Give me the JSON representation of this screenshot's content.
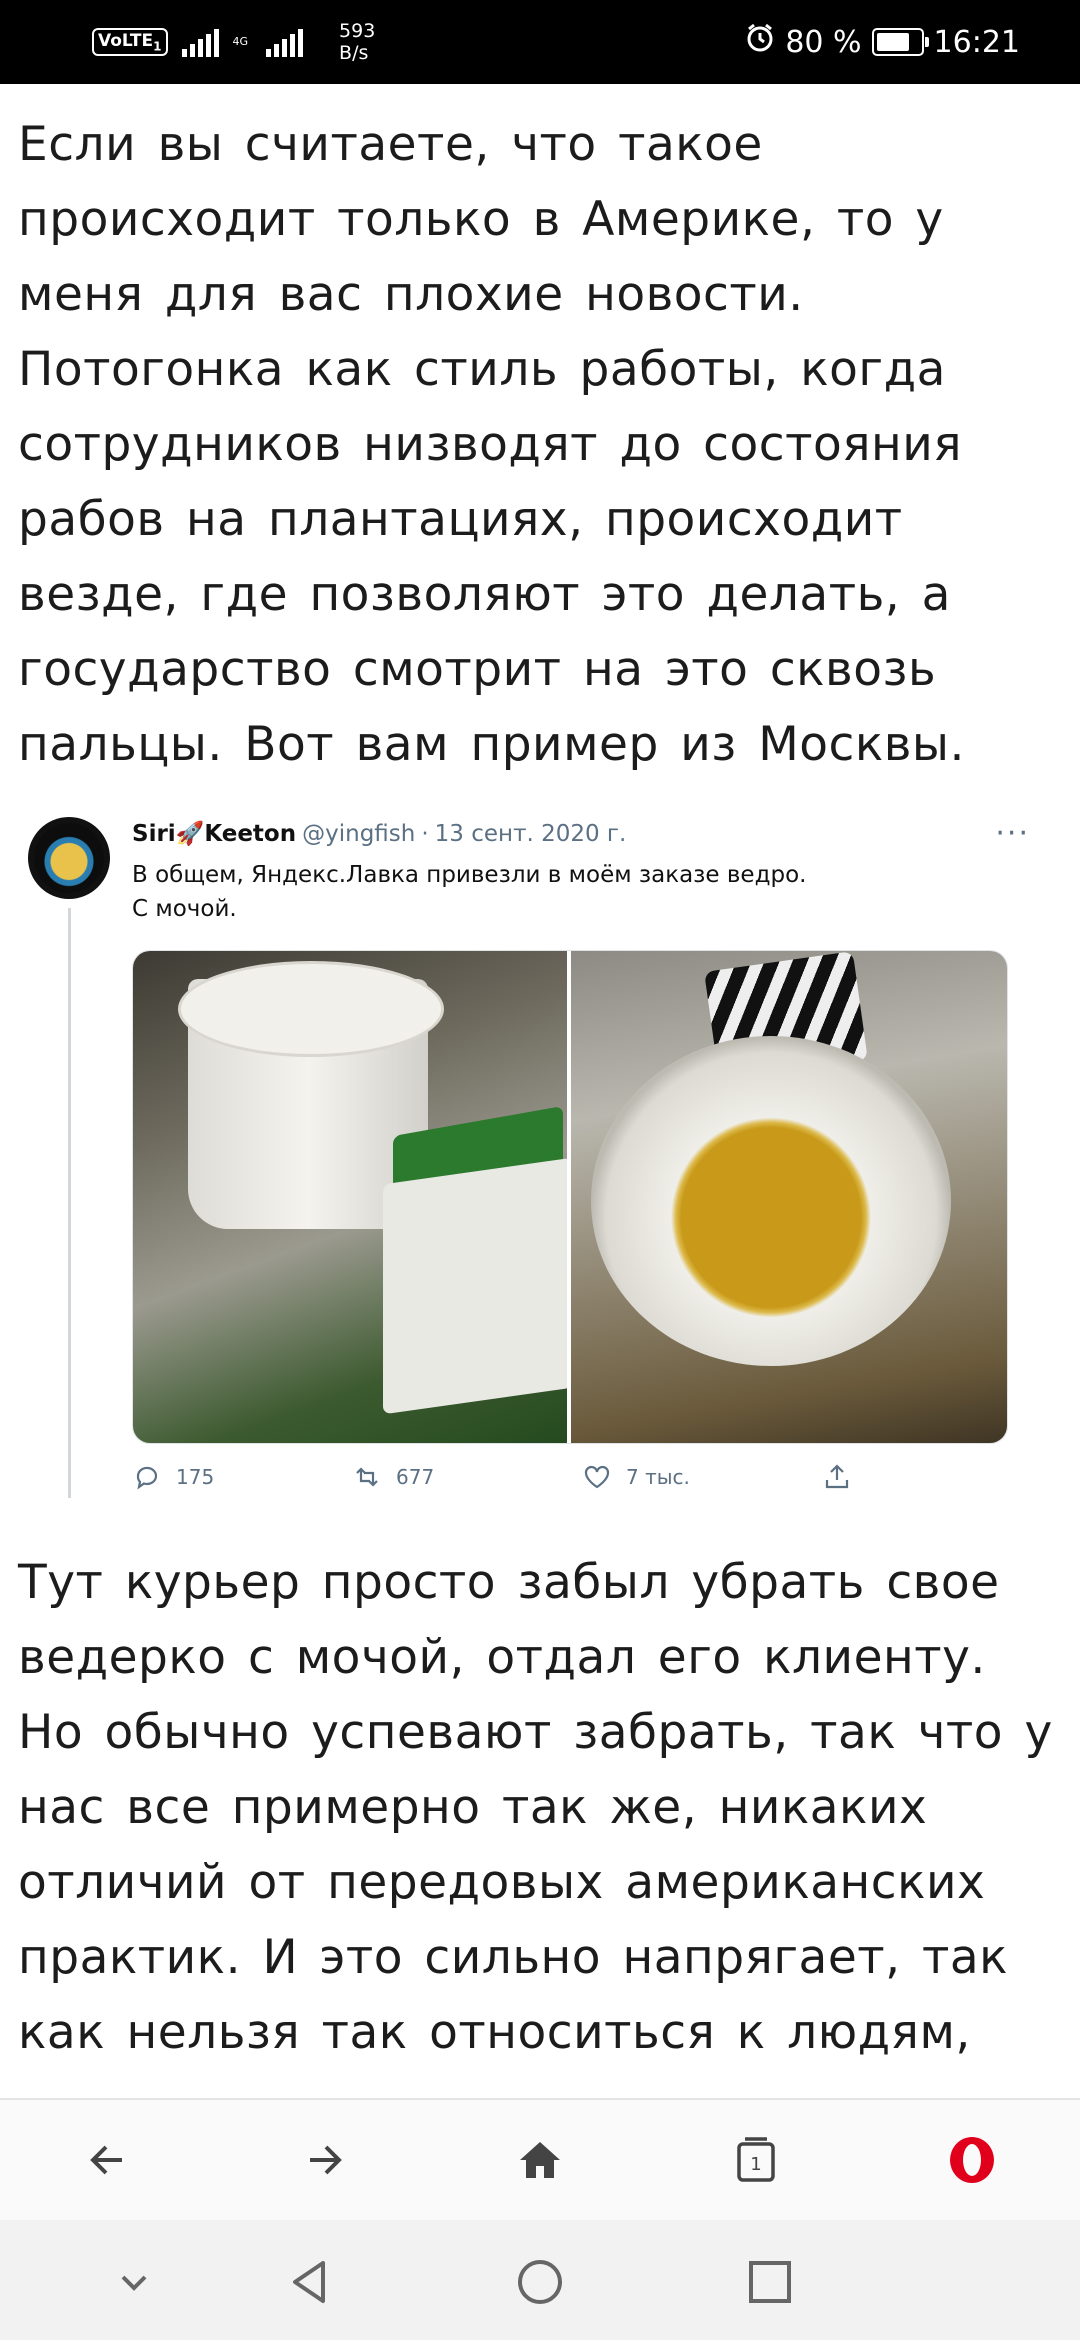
{
  "status_bar": {
    "volte": "VoLTE",
    "volte_sim": "1",
    "network": "4G",
    "speed_value": "593",
    "speed_unit": "B/s",
    "battery": "80 %",
    "battery_level": 0.8,
    "time": "16:21"
  },
  "article": {
    "paragraph_1_lines": [
      "Если вы считаете, что такое",
      "происходит только в Америке, то у",
      "меня для вас плохие новости.",
      "Потогонка как стиль работы, когда",
      "сотрудников низводят до состояния",
      "рабов на плантациях, происходит",
      "везде, где позволяют это делать, а",
      "государство смотрит на это сквозь",
      "пальцы. Вот вам пример из Москвы."
    ],
    "paragraph_2_lines": [
      "Тут курьер просто забыл убрать свое",
      "ведерко с мочой, отдал его клиенту.",
      "Но обычно успевают забрать, так что у",
      "нас все примерно так же, никаких",
      "отличий от передовых американских",
      "практик. И это сильно напрягает, так",
      "как нельзя так относиться к людям,"
    ]
  },
  "tweet": {
    "name": "Siri🚀Keeton",
    "handle": "@yingfish",
    "separator": "·",
    "date": "13 сент. 2020 г.",
    "more": "···",
    "text": "В общем, Яндекс.Лавка привезли в моём заказе ведро.\nС мочой.",
    "replies": "175",
    "retweets": "677",
    "likes": "7 тыс.",
    "icons": [
      "reply-icon",
      "retweet-icon",
      "heart-icon",
      "share-icon"
    ]
  },
  "browser_bar": {
    "tab_count": "1",
    "buttons": [
      "back-icon",
      "forward-icon",
      "home-icon",
      "tabs-icon",
      "opera-icon"
    ],
    "accent": "#e0001b"
  },
  "system_nav": {
    "buttons": [
      "hide-keyboard-icon",
      "nav-back-icon",
      "nav-home-icon",
      "nav-recents-icon"
    ]
  }
}
